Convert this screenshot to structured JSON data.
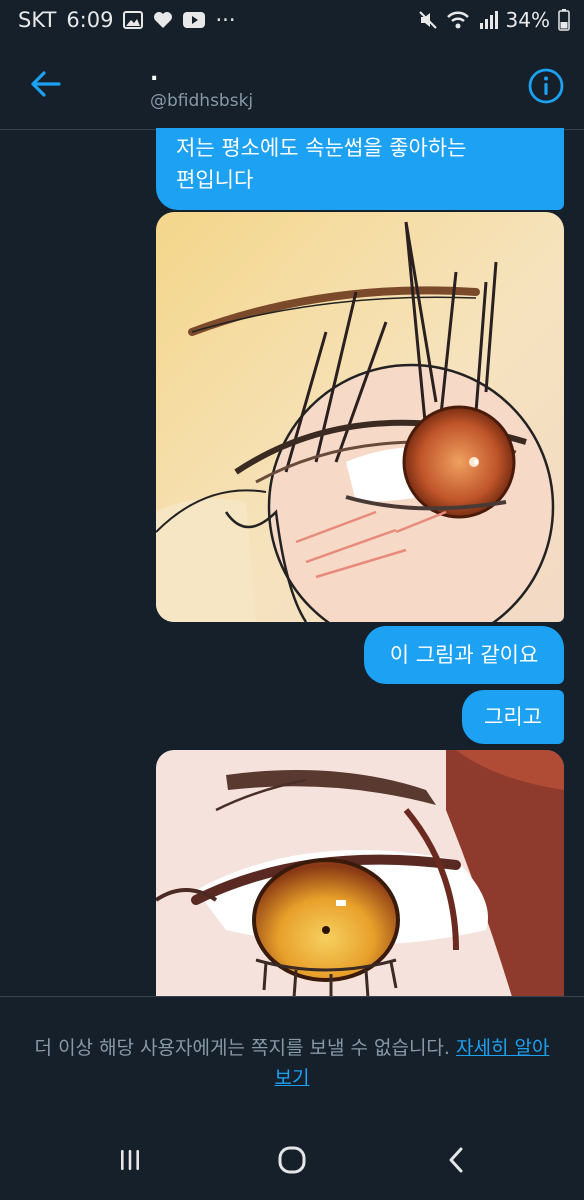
{
  "status_bar": {
    "carrier": "SKT",
    "time": "6:09",
    "more": "···",
    "battery": "34%"
  },
  "header": {
    "name": ".",
    "handle": "@bfidhsbskj"
  },
  "messages": [
    {
      "type": "text",
      "text_line1": "저는 평소에도 속눈썹을 좋아하는",
      "text_line2": "편입니다"
    },
    {
      "type": "image"
    },
    {
      "type": "text",
      "text": "이 그림과 같이요"
    },
    {
      "type": "text",
      "text": "그리고"
    },
    {
      "type": "image"
    }
  ],
  "notice": {
    "text": "더 이상 해당 사용자에게는 쪽지를 보낼 수 없습니다. ",
    "link": "자세히 알아보기"
  },
  "colors": {
    "background": "#15202b",
    "accent": "#1da1f2",
    "muted": "#8899a6"
  }
}
